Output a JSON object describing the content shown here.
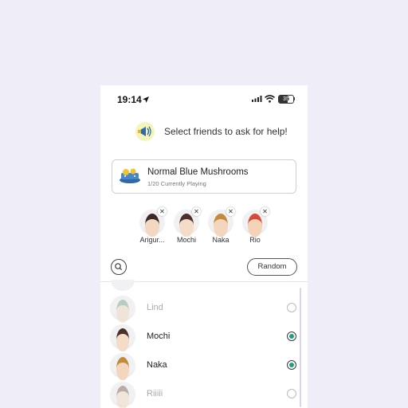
{
  "status_bar": {
    "time": "19:14",
    "battery": "35"
  },
  "header": {
    "title": "Select friends to ask for help!"
  },
  "game": {
    "title": "Normal Blue Mushrooms",
    "subtitle": "1/20 Currently Playing"
  },
  "selected_friends": [
    {
      "name": "Arigur..."
    },
    {
      "name": "Mochi"
    },
    {
      "name": "Naka"
    },
    {
      "name": "Rio"
    }
  ],
  "actions": {
    "random_label": "Random"
  },
  "friends": [
    {
      "name": "Lind",
      "selected": false
    },
    {
      "name": "Mochi",
      "selected": true
    },
    {
      "name": "Naka",
      "selected": true
    },
    {
      "name": "Riiiii",
      "selected": false
    }
  ]
}
